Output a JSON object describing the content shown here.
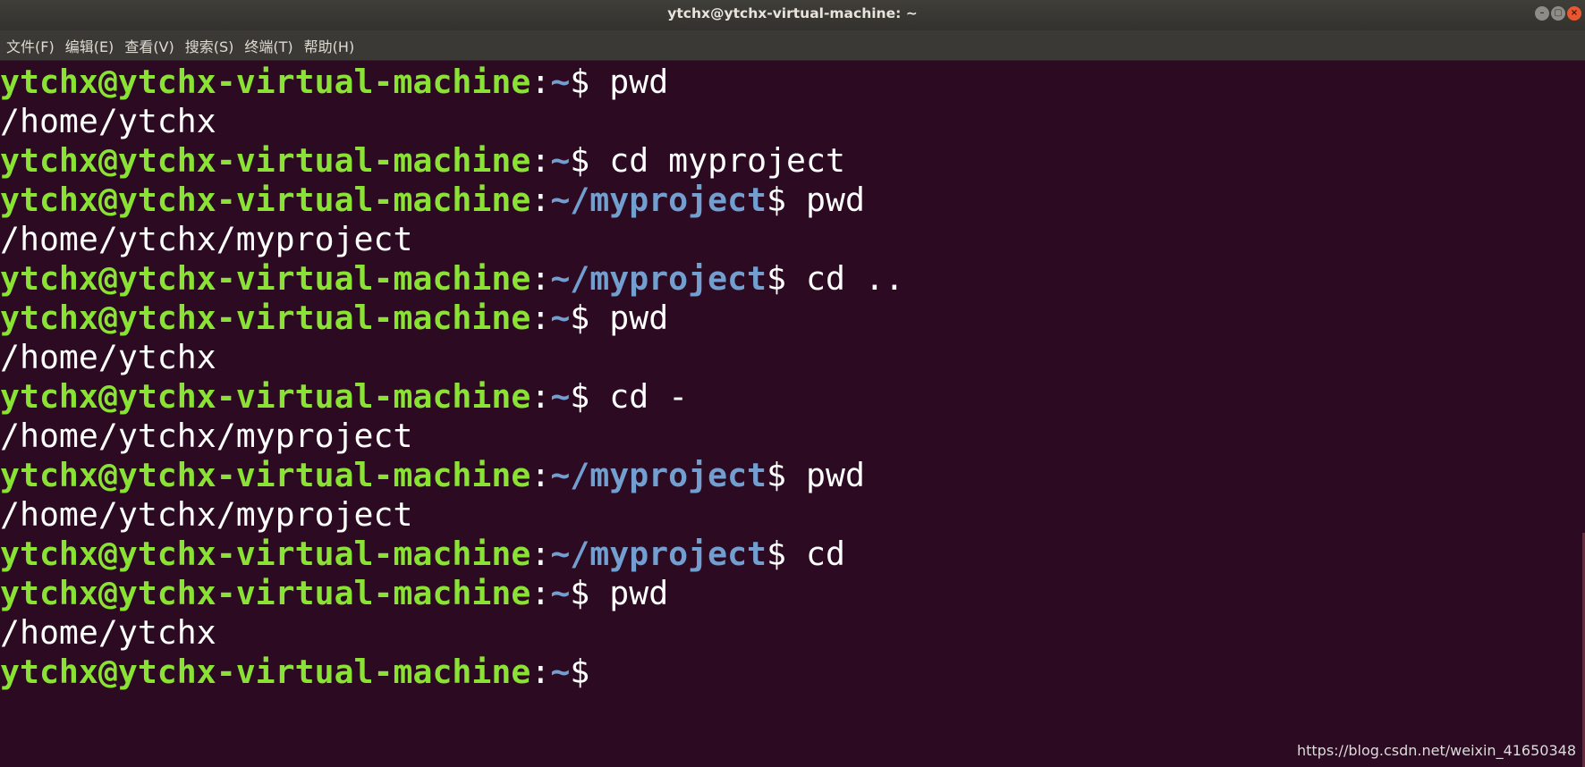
{
  "window": {
    "title": "ytchx@ytchx-virtual-machine: ~",
    "controls": [
      "–",
      "▢",
      "×"
    ]
  },
  "menu": [
    "文件(F)",
    "编辑(E)",
    "查看(V)",
    "搜索(S)",
    "终端(T)",
    "帮助(H)"
  ],
  "colors": {
    "background": "#2c0a22",
    "prompt_user": "#8ae234",
    "prompt_path": "#729fcf",
    "text": "#ffffff"
  },
  "terminal": {
    "lines": [
      {
        "type": "prompt",
        "user": "ytchx@ytchx-virtual-machine",
        "path": "~",
        "command": "pwd"
      },
      {
        "type": "output",
        "text": "/home/ytchx"
      },
      {
        "type": "prompt",
        "user": "ytchx@ytchx-virtual-machine",
        "path": "~",
        "command": "cd myproject"
      },
      {
        "type": "prompt",
        "user": "ytchx@ytchx-virtual-machine",
        "path": "~/myproject",
        "command": "pwd"
      },
      {
        "type": "output",
        "text": "/home/ytchx/myproject"
      },
      {
        "type": "prompt",
        "user": "ytchx@ytchx-virtual-machine",
        "path": "~/myproject",
        "command": "cd .."
      },
      {
        "type": "prompt",
        "user": "ytchx@ytchx-virtual-machine",
        "path": "~",
        "command": "pwd"
      },
      {
        "type": "output",
        "text": "/home/ytchx"
      },
      {
        "type": "prompt",
        "user": "ytchx@ytchx-virtual-machine",
        "path": "~",
        "command": "cd -"
      },
      {
        "type": "output",
        "text": "/home/ytchx/myproject"
      },
      {
        "type": "prompt",
        "user": "ytchx@ytchx-virtual-machine",
        "path": "~/myproject",
        "command": "pwd"
      },
      {
        "type": "output",
        "text": "/home/ytchx/myproject"
      },
      {
        "type": "prompt",
        "user": "ytchx@ytchx-virtual-machine",
        "path": "~/myproject",
        "command": "cd"
      },
      {
        "type": "prompt",
        "user": "ytchx@ytchx-virtual-machine",
        "path": "~",
        "command": "pwd"
      },
      {
        "type": "output",
        "text": "/home/ytchx"
      },
      {
        "type": "prompt",
        "user": "ytchx@ytchx-virtual-machine",
        "path": "~",
        "command": ""
      }
    ]
  },
  "watermark": "https://blog.csdn.net/weixin_41650348"
}
